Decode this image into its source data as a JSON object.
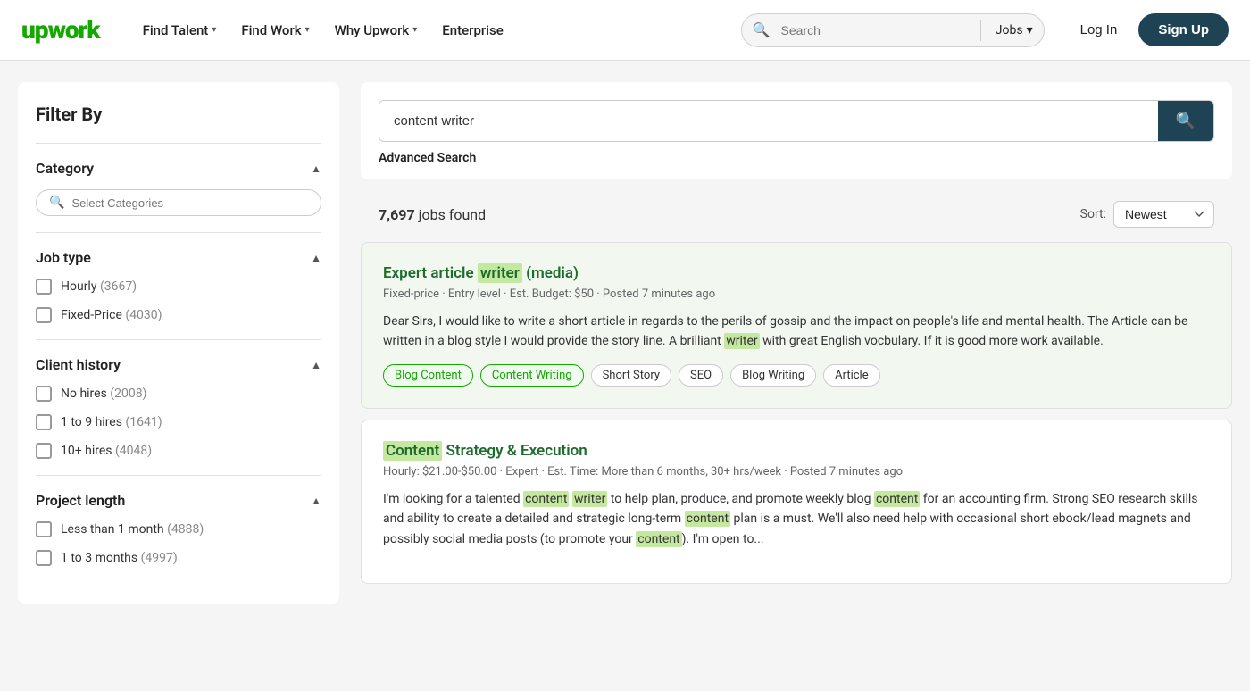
{
  "navbar": {
    "logo": "upwork",
    "links": [
      {
        "label": "Find Talent",
        "has_dropdown": true
      },
      {
        "label": "Find Work",
        "has_dropdown": true
      },
      {
        "label": "Why Upwork",
        "has_dropdown": true
      },
      {
        "label": "Enterprise",
        "has_dropdown": false
      }
    ],
    "search_placeholder": "Search",
    "search_type": "Jobs",
    "login_label": "Log In",
    "signup_label": "Sign Up"
  },
  "sidebar": {
    "title": "Filter By",
    "category": {
      "label": "Category",
      "search_placeholder": "Select Categories"
    },
    "job_type": {
      "label": "Job type",
      "options": [
        {
          "label": "Hourly",
          "count": "(3667)"
        },
        {
          "label": "Fixed-Price",
          "count": "(4030)"
        }
      ]
    },
    "client_history": {
      "label": "Client history",
      "options": [
        {
          "label": "No hires",
          "count": "(2008)"
        },
        {
          "label": "1 to 9 hires",
          "count": "(1641)"
        },
        {
          "label": "10+ hires",
          "count": "(4048)"
        }
      ]
    },
    "project_length": {
      "label": "Project length",
      "options": [
        {
          "label": "Less than 1 month",
          "count": "(4888)"
        },
        {
          "label": "1 to 3 months",
          "count": "(4997)"
        }
      ]
    }
  },
  "search": {
    "query": "content writer",
    "advanced_label": "Advanced Search",
    "results_count": "7,697",
    "results_label": "jobs found",
    "sort_label": "Sort:",
    "sort_value": "Newest"
  },
  "jobs": [
    {
      "id": 1,
      "title_parts": [
        {
          "text": "Expert article ",
          "highlight": false
        },
        {
          "text": "writer",
          "highlight": true
        },
        {
          "text": " (media)",
          "highlight": false
        }
      ],
      "meta": "Fixed-price · Entry level · Est. Budget: $50 · Posted 7 minutes ago",
      "description": "Dear Sirs, I would like to write a short article in regards to the perils of gossip and the impact on people's life and mental health. The Article can be written in a blog style I would provide the story line. A brilliant writer with great English vocbulary. If it is good more work available.",
      "desc_highlights": [
        "writer"
      ],
      "tags": [
        {
          "label": "Blog Content",
          "highlighted": true
        },
        {
          "label": "Content Writing",
          "highlighted": true
        },
        {
          "label": "Short Story",
          "highlighted": false
        },
        {
          "label": "SEO",
          "highlighted": false
        },
        {
          "label": "Blog Writing",
          "highlighted": false
        },
        {
          "label": "Article",
          "highlighted": false
        }
      ],
      "bg": true
    },
    {
      "id": 2,
      "title_parts": [
        {
          "text": "Content",
          "highlight": true
        },
        {
          "text": " Strategy & Execution",
          "highlight": false
        }
      ],
      "meta": "Hourly: $21.00-$50.00 · Expert · Est. Time: More than 6 months, 30+ hrs/week · Posted 7 minutes ago",
      "description": "I'm looking for a talented content writer to help plan, produce, and promote weekly blog content for an accounting firm. Strong SEO research skills and ability to create a detailed and strategic long-term content plan is a must. We'll also need help with occasional short ebook/lead magnets and possibly social media posts (to promote your content). I'm open to...",
      "desc_highlights": [
        "content",
        "writer",
        "content",
        "content",
        "content"
      ],
      "tags": [],
      "bg": false
    }
  ]
}
